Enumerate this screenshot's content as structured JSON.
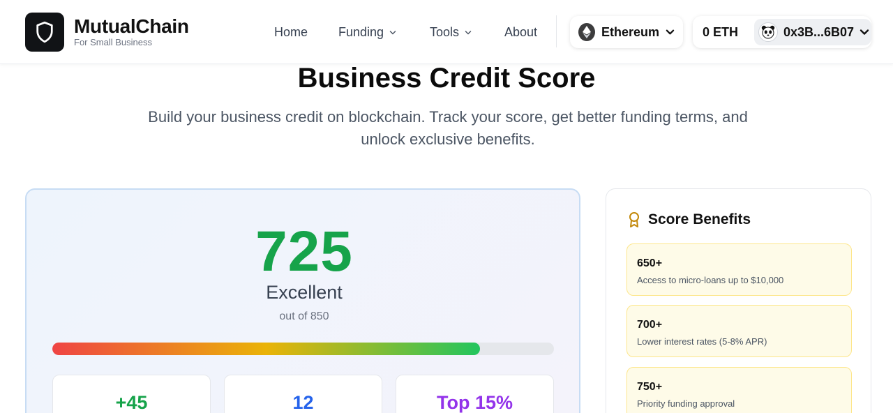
{
  "brand": {
    "name": "MutualChain",
    "tagline": "For Small Business"
  },
  "nav": {
    "home": "Home",
    "funding": "Funding",
    "tools": "Tools",
    "about": "About"
  },
  "network": {
    "label": "Ethereum"
  },
  "wallet": {
    "balance": "0 ETH",
    "address": "0x3B...6B07"
  },
  "hero": {
    "title": "Business Credit Score",
    "subtitle": "Build your business credit on blockchain. Track your score, get better funding terms, and unlock exclusive benefits."
  },
  "score": {
    "value": "725",
    "rating": "Excellent",
    "max_text": "out of 850",
    "progress_fraction": 0.853,
    "stats": [
      {
        "value": "+45",
        "color": "#16a34a"
      },
      {
        "value": "12",
        "color": "#2563eb"
      },
      {
        "value": "Top 15%",
        "color": "#9333ea"
      }
    ]
  },
  "benefits": {
    "title": "Score Benefits",
    "items": [
      {
        "tier": "650+",
        "desc": "Access to micro-loans up to $10,000"
      },
      {
        "tier": "700+",
        "desc": "Lower interest rates (5-8% APR)"
      },
      {
        "tier": "750+",
        "desc": "Priority funding approval"
      }
    ]
  },
  "colors": {
    "score": "#16a34a",
    "benefit_bg": "#fefbe8",
    "benefit_border": "#fde68a",
    "accent_gold": "#b45309"
  }
}
